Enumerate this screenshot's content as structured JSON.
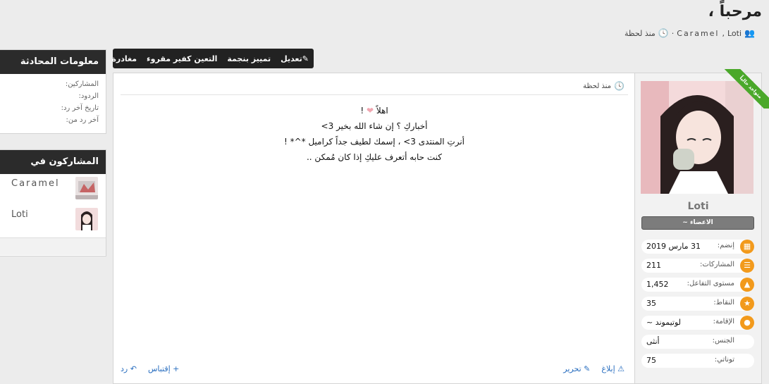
{
  "thread": {
    "title": "مرحباً ،",
    "starter": "Loti",
    "participant": "Caramel",
    "time": "منذ لحظة"
  },
  "toolbar": {
    "edit": "تعديل",
    "star": "تمييز بنجمة",
    "assign": "التعين كفير مقروء",
    "leave": "مغادرة"
  },
  "info": {
    "title": "معلومات المحادثة",
    "rows": [
      "المشاركين:",
      "الردود:",
      "تاريخ آخر رد:",
      "آخر رد من:"
    ]
  },
  "participants": {
    "title": "المشاركون في المحادثة",
    "items": [
      {
        "name": "Caramel"
      },
      {
        "name": "Loti"
      }
    ]
  },
  "post": {
    "time": "منذ لحظة",
    "lines": [
      "اهلاً",
      "أخباركِ ؟ إن شاء الله بخير 3>",
      "أنرتِ المنتدى 3> ، إسمك لطيف جداً كراميل *^* !",
      "كنت حابه أتعرف عليكِ إذا كان مُمكن .."
    ],
    "line1_end": "!",
    "actions": {
      "report": "إبلاغ",
      "edit": "تحرير",
      "quote": "إقتباس",
      "reply": "رد"
    }
  },
  "user": {
    "name": "Loti",
    "role": "الاعضاء ~",
    "online": "متواجد حالياً",
    "stats": [
      {
        "label": "إنضم:",
        "value": "31 مارس 2019",
        "icon": "calendar-icon"
      },
      {
        "label": "المشاركات:",
        "value": "211",
        "icon": "comments-icon"
      },
      {
        "label": "مستوى التفاعل:",
        "value": "1,452",
        "icon": "thumbs-up-icon"
      },
      {
        "label": "النقاط:",
        "value": "35",
        "icon": "trophy-icon"
      },
      {
        "label": "الإقامة:",
        "value": "لوتيموند ~",
        "icon": "map-pin-icon"
      },
      {
        "label": "الجنس:",
        "value": "أنثى"
      },
      {
        "label": "توناتي:",
        "value": "75"
      }
    ]
  },
  "colors": {
    "accent": "#f29a1c",
    "online": "#4aa82a",
    "link": "#2a6fc0",
    "header": "#2b2b2b"
  }
}
